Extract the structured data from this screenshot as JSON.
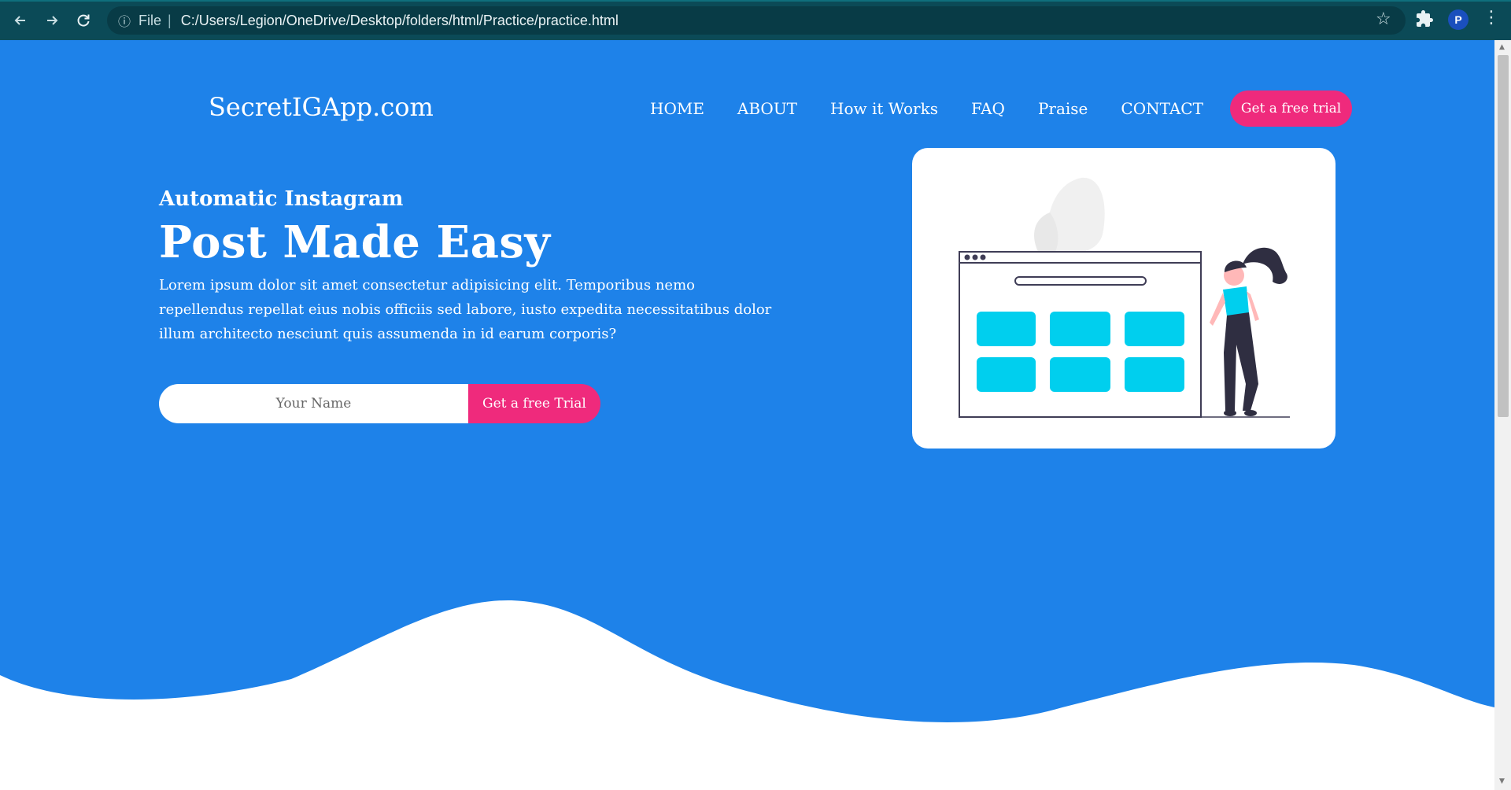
{
  "browser": {
    "url_scheme": "File",
    "url": "C:/Users/Legion/OneDrive/Desktop/folders/html/Practice/practice.html",
    "profile_initial": "P",
    "icons": [
      "back-arrow-icon",
      "forward-arrow-icon",
      "reload-icon",
      "info-icon",
      "star-icon",
      "extensions-puzzle-icon",
      "menu-dots-icon"
    ]
  },
  "site": {
    "brand": "SecretIGApp.com",
    "nav": [
      {
        "label": "HOME"
      },
      {
        "label": "ABOUT"
      },
      {
        "label": "How it Works"
      },
      {
        "label": "FAQ"
      },
      {
        "label": "Praise"
      },
      {
        "label": "CONTACT"
      }
    ],
    "nav_cta": "Get a free trial"
  },
  "hero": {
    "eyebrow": "Automatic Instagram",
    "headline": "Post Made Easy",
    "paragraph": "Lorem ipsum dolor sit amet consectetur adipisicing elit. Temporibus nemo repellendus repellat eius nobis officiis sed labore, iusto expedita necessitatibus dolor illum architecto nesciunt quis assumenda in id earum corporis?",
    "input_placeholder": "Your Name",
    "cta": "Get a free Trial"
  },
  "colors": {
    "hero_bg": "#1e82e9",
    "accent_pink": "#ef2a7c",
    "chrome_bg": "#0b4a57",
    "tile_cyan": "#00cfee"
  }
}
